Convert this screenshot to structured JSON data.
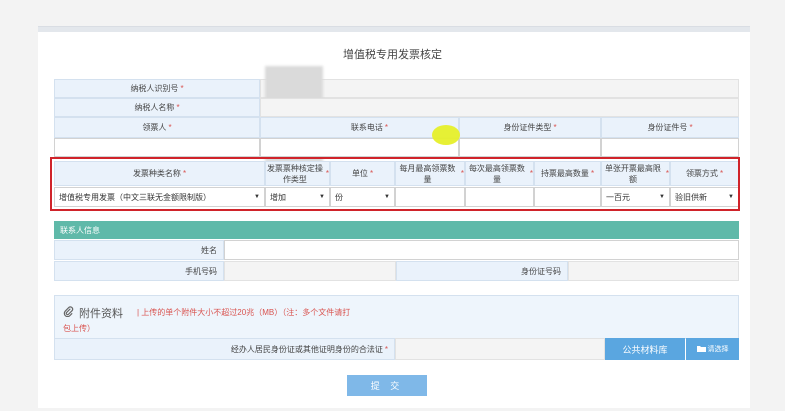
{
  "page_title": "增值税专用发票核定",
  "taxpayer": {
    "id_label": "纳税人识别号",
    "name_label": "纳税人名称",
    "receiver_label": "领票人",
    "phone_label": "联系电话",
    "id_type_label": "身份证件类型",
    "id_no_label": "身份证件号",
    "required_mark": "*"
  },
  "invoice_table": {
    "headers": {
      "invoice_type": "发票种类名称",
      "operation_type": "发票票种核定操作类型",
      "unit": "单位",
      "monthly_max": "每月最高领票数量",
      "per_time_max": "每次最高领票数量",
      "max_held": "持票最高数量",
      "max_amount": "单张开票最高限额",
      "method": "领票方式"
    },
    "row": {
      "invoice_type": "增值税专用发票（中文三联无金额限制版）",
      "operation_type": "增加",
      "unit": "份",
      "monthly_max": "",
      "per_time_max": "",
      "max_held": "",
      "max_amount": "一百元",
      "method": "验旧供新"
    }
  },
  "contact": {
    "section_title": "联系人信息",
    "name_label": "姓名",
    "mobile_label": "手机号码",
    "id_label": "身份证号码"
  },
  "attachments": {
    "title": "附件资料",
    "note_line1": "| 上传的单个附件大小不超过20兆（MB）（注：多个文件请打",
    "note_line2": "包上传）",
    "proof_label": "经办人居民身份证或其他证明身份的合法证",
    "public_library_button": "公共材料库",
    "pick_button": "请选择"
  },
  "submit_button": "提 交",
  "colors": {
    "highlight_border": "#d0232a",
    "section_bar": "#5fb9a9",
    "button_blue": "#5aa6e0",
    "label_bg": "#eaf2fb",
    "required_red": "#d9534f"
  }
}
